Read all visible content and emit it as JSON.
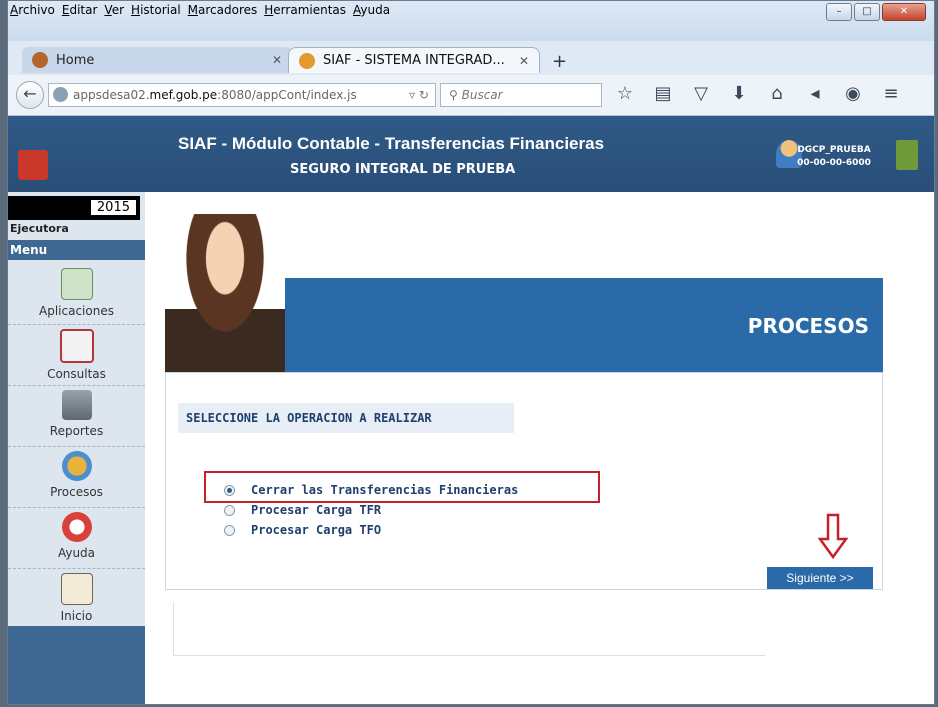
{
  "browser": {
    "menu": [
      "Archivo",
      "Editar",
      "Ver",
      "Historial",
      "Marcadores",
      "Herramientas",
      "Ayuda"
    ],
    "tabs": [
      {
        "title": "Home"
      },
      {
        "title": "SIAF - SISTEMA INTEGRAD..."
      }
    ],
    "url_prefix": "appsdesa02.",
    "url_domain": "mef.gob.pe",
    "url_suffix": ":8080/appCont/index.js",
    "search_placeholder": "Buscar"
  },
  "header": {
    "title": "SIAF - Módulo Contable - Transferencias Financieras",
    "subtitle": "SEGURO INTEGRAL DE PRUEBA",
    "user": "DGCP_PRUEBA",
    "user_code": "00-00-00-6000"
  },
  "sidebar": {
    "year": "2015",
    "ejecutora": "Ejecutora",
    "menu_label": "Menu",
    "items": [
      {
        "label": "Aplicaciones"
      },
      {
        "label": "Consultas"
      },
      {
        "label": "Reportes"
      },
      {
        "label": "Procesos"
      },
      {
        "label": "Ayuda"
      },
      {
        "label": "Inicio"
      }
    ]
  },
  "main": {
    "banner_title": "PROCESOS",
    "select_label": "SELECCIONE LA OPERACION A REALIZAR",
    "options": [
      {
        "label": "Cerrar las Transferencias Financieras",
        "selected": true
      },
      {
        "label": "Procesar Carga TFR",
        "selected": false
      },
      {
        "label": "Procesar Carga TFO",
        "selected": false
      }
    ],
    "next_button": "Siguiente >>"
  },
  "colors": {
    "header_blue": "#2f5a86",
    "banner_blue": "#2b6aa8",
    "highlight_red": "#c8202a"
  }
}
